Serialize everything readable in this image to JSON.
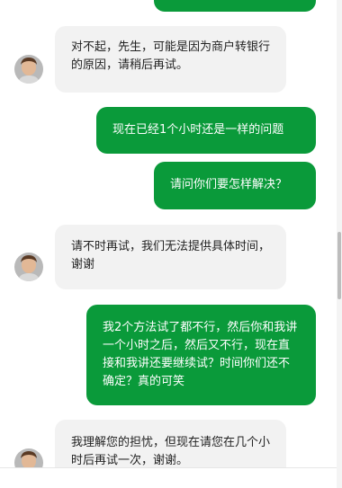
{
  "messages": [
    {
      "id": 0,
      "side": "out",
      "text": ""
    },
    {
      "id": 1,
      "side": "in",
      "text": "对不起，先生，可能是因为商户转银行的原因，请稍后再试。"
    },
    {
      "id": 2,
      "side": "out",
      "text": "现在已经1个小时还是一样的问题"
    },
    {
      "id": 3,
      "side": "out",
      "text": "请问你们要怎样解决？"
    },
    {
      "id": 4,
      "side": "in",
      "text": "请不时再试，我们无法提供具体时间，谢谢"
    },
    {
      "id": 5,
      "side": "out",
      "text": "我2个方法试了都不行，然后你和我讲一个小时之后，然后又不行，现在直接和我讲还要继续试？时间你们还不确定？真的可笑"
    },
    {
      "id": 6,
      "side": "in",
      "text": "我理解您的担忧，但现在请您在几个小时后再试一次，谢谢。"
    }
  ],
  "colors": {
    "outgoing_bubble": "#0a9a3a",
    "incoming_bubble": "#f2f2f2",
    "outgoing_text": "#ffffff",
    "incoming_text": "#222222"
  }
}
